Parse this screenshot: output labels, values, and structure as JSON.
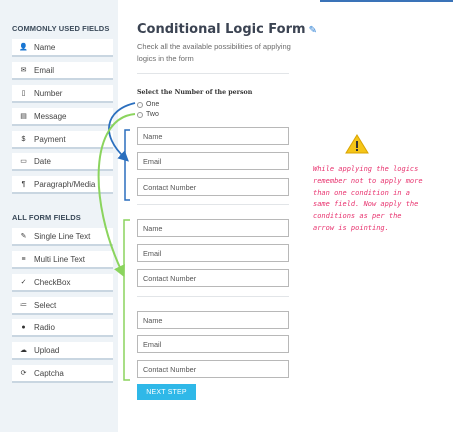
{
  "sidebar": {
    "common_title": "COMMONLY USED FIELDS",
    "common_items": [
      {
        "label": "Name",
        "icon": "user-icon",
        "glyph": "👤"
      },
      {
        "label": "Email",
        "icon": "envelope-icon",
        "glyph": "✉"
      },
      {
        "label": "Number",
        "icon": "phone-icon",
        "glyph": "▯"
      },
      {
        "label": "Message",
        "icon": "message-icon",
        "glyph": "▤"
      },
      {
        "label": "Payment",
        "icon": "dollar-icon",
        "glyph": "$"
      },
      {
        "label": "Date",
        "icon": "calendar-icon",
        "glyph": "▭"
      },
      {
        "label": "Paragraph/Media",
        "icon": "paragraph-icon",
        "glyph": "¶"
      }
    ],
    "all_title": "ALL FORM FIELDS",
    "all_items": [
      {
        "label": "Single Line Text",
        "icon": "pencil-icon",
        "glyph": "✎"
      },
      {
        "label": "Multi Line Text",
        "icon": "lines-icon",
        "glyph": "≡"
      },
      {
        "label": "CheckBox",
        "icon": "check-icon",
        "glyph": "✓"
      },
      {
        "label": "Select",
        "icon": "list-icon",
        "glyph": "≔"
      },
      {
        "label": "Radio",
        "icon": "radio-dot-icon",
        "glyph": "●"
      },
      {
        "label": "Upload",
        "icon": "cloud-upload-icon",
        "glyph": "☁"
      },
      {
        "label": "Captcha",
        "icon": "refresh-icon",
        "glyph": "⟳"
      }
    ]
  },
  "form": {
    "title": "Conditional Logic Form",
    "description": "Check all the available possibilities of applying logics in the form",
    "question": "Select the Number of the person",
    "options": [
      "One",
      "Two"
    ],
    "group1": [
      "Name",
      "Email",
      "Contact Number"
    ],
    "group2": [
      "Name",
      "Email",
      "Contact Number"
    ],
    "group3": [
      "Name",
      "Email",
      "Contact Number"
    ],
    "next_label": "NEXT STEP"
  },
  "note": "While applying the logics remember not to apply more than one condition in a same field. Now apply the conditions as per the arrow is pointing.",
  "colors": {
    "accent_blue": "#2b7fd4",
    "button": "#2fb8e8",
    "note_pink": "#e8326e",
    "arrow_green": "#8bd45e",
    "warning_yellow": "#f5c518"
  }
}
